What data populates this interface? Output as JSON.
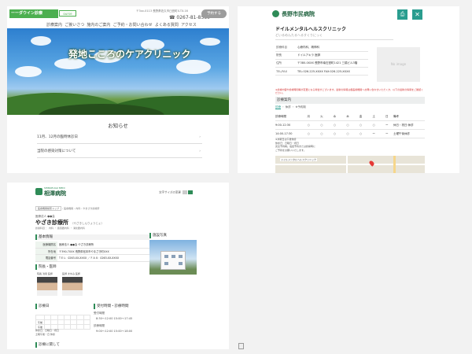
{
  "panel1": {
    "logo": "ーーダウイン診療",
    "logo_tag": "ourse",
    "address": "〒3xx-0113 長野県佐久市臼田町X-TX-16",
    "tel": "0267-81-8560",
    "cta": "予約する",
    "nav": [
      "診療案内",
      "ご挨いさつ",
      "施内のご案内",
      "ご予約・お問い合わせ",
      "よくある質問",
      "アクセス"
    ],
    "hero_title": "発地こころのケアクリニック",
    "news_heading": "お知らせ",
    "news": [
      "11月、12月の臨時休診日",
      "当院の感染対策について"
    ]
  },
  "panel2": {
    "logo": "長野市民病院",
    "print_icon": "printer-icon",
    "close_icon": "close-icon",
    "clinic_name": "ドイルメンタルヘルスクリニック",
    "clinic_kana": "どいるめんたるへるすくりにっく",
    "info": [
      {
        "k": "診療科目",
        "v": "心療内科、精神科"
      },
      {
        "k": "院長",
        "v": "ドイルアキラ 医師"
      },
      {
        "k": "住所",
        "v": "〒380-0XXX 長野市南石堂町1421 三橋ビル3階"
      },
      {
        "k": "TEL/FAX",
        "v": "TEL:026-225-XXXX FAX:026-225-XXXX"
      }
    ],
    "no_image": "No image",
    "warning": "※診療内容や診療時間等が変更になる場合がございます。最新の情報は各医療機関へお問い合わせいただくか、以下の最新の情報をご確認ください。",
    "section": "診療案内",
    "tabs": [
      "診療",
      "休診",
      "※予約制"
    ],
    "hours_head": [
      "診療時間",
      "月",
      "火",
      "水",
      "木",
      "金",
      "土",
      "日",
      "備考"
    ],
    "hours": [
      {
        "label": "9:00-12:30",
        "cells": [
          "○",
          "○",
          "○",
          "○",
          "○",
          "○",
          "ー"
        ],
        "note": "休日・祝日:休診"
      },
      {
        "label": "14:00-17:30",
        "cells": [
          "○",
          "○",
          "○",
          "○",
          "○",
          "ー",
          "ー"
        ],
        "note": "土曜午後休診"
      }
    ],
    "notes": [
      "※水曜日は午後休診",
      "休診日：日曜日・祝日",
      "完全予約制。電話予約または診察時に",
      "ご予約をお願いいたします。"
    ],
    "map_label": "ドイルメンタルヘルスクリニック"
  },
  "panel3": {
    "logo_small": "SHINSEI-KAI MEDI",
    "logo": "相澤病院",
    "font_size_label": "文字サイズの変更",
    "font_sizes": [
      "標準",
      "大"
    ],
    "crumb": [
      "医療機関検索トップ",
      "医療機関",
      "内科",
      "やまざき診療所"
    ],
    "kind": "医療法人 ●●会",
    "name": "やざき診療所",
    "kana": "（やざきしんりょうじょ）",
    "tags": [
      "診療科目",
      "内科",
      "循環器内科",
      "消化器内科"
    ],
    "basic_heading": "基本情報",
    "basic": [
      {
        "k": "医療機関名",
        "v": "医療法人 ●●会 やざき診療所"
      },
      {
        "k": "所在地",
        "v": "〒390-7XXX 長野県松本市やまざき町XXX"
      },
      {
        "k": "電話番号",
        "v": "T E L：0263-XX-XXXX ／ F A X：0263-XX-XXXX"
      }
    ],
    "photo_heading": "施設写真",
    "staff_heading": "院長・医師",
    "staff": [
      "院長 浅間 医師",
      "医師 まゆみ 医師"
    ],
    "hours_heading": "診療日",
    "hours_rows": [
      "午前",
      "午後"
    ],
    "hours_note": [
      "休診日：日曜日・祝日",
      "土曜午後・日 休診"
    ],
    "reception_heading": "受付時間・診療時間",
    "reception_label": "受付時間",
    "reception": "8:30〜12:00  15:00〜17:45",
    "clinic_label": "診療時間",
    "clinic_hours": "9:00〜12:00  15:00〜18:00",
    "about_heading": "診療に関して"
  }
}
